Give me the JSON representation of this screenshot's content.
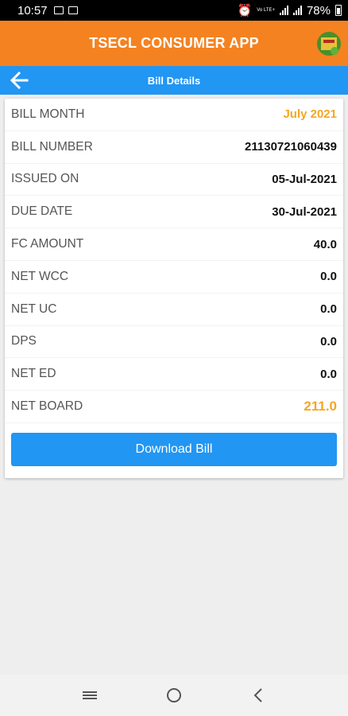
{
  "status_bar": {
    "time": "10:57",
    "network": "Vo LTE+",
    "battery": "78%"
  },
  "app_bar": {
    "title": "TSECL CONSUMER APP",
    "logo_icon": "tsecl-logo-icon"
  },
  "sub_bar": {
    "title": "Bill Details",
    "back_icon": "arrow-left-icon"
  },
  "bill": {
    "rows": [
      {
        "label": "BILL MONTH",
        "value": "July 2021",
        "highlight": true
      },
      {
        "label": "BILL NUMBER",
        "value": "21130721060439"
      },
      {
        "label": "ISSUED ON",
        "value": "05-Jul-2021"
      },
      {
        "label": "DUE DATE",
        "value": "30-Jul-2021"
      },
      {
        "label": "FC AMOUNT",
        "value": "40.0"
      },
      {
        "label": "NET WCC",
        "value": "0.0"
      },
      {
        "label": "NET UC",
        "value": "0.0"
      },
      {
        "label": "DPS",
        "value": "0.0"
      },
      {
        "label": "NET ED",
        "value": "0.0"
      },
      {
        "label": "NET BOARD",
        "value": "211.0",
        "highlight": true
      }
    ],
    "download_label": "Download Bill"
  },
  "colors": {
    "orange": "#f58220",
    "blue": "#2196f3",
    "accent": "#f5a623"
  },
  "nav_bar": {
    "recent_icon": "recent-apps-icon",
    "home_icon": "home-circle-icon",
    "back_icon": "back-chevron-icon"
  }
}
